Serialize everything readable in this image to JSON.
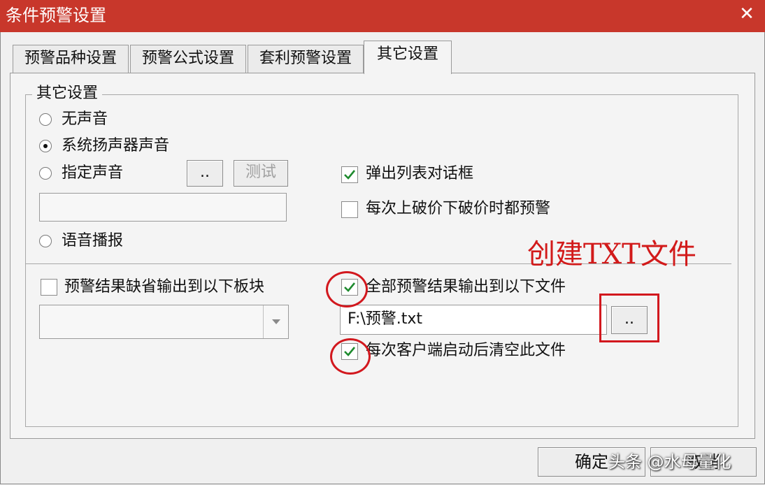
{
  "window": {
    "title": "条件预警设置",
    "close_glyph": "✕"
  },
  "tabs": [
    {
      "label": "预警品种设置",
      "active": false
    },
    {
      "label": "预警公式设置",
      "active": false
    },
    {
      "label": "套利预警设置",
      "active": false
    },
    {
      "label": "其它设置",
      "active": true
    }
  ],
  "group": {
    "title": "其它设置"
  },
  "sound": {
    "options": [
      {
        "label": "无声音",
        "selected": false
      },
      {
        "label": "系统扬声器声音",
        "selected": true
      },
      {
        "label": "指定声音",
        "selected": false
      },
      {
        "label": "语音播报",
        "selected": false
      }
    ],
    "browse_label": "..",
    "test_label": "测试",
    "path_value": ""
  },
  "options": {
    "popup_list": {
      "label": "弹出列表对话框",
      "checked": true
    },
    "every_breakout": {
      "label": "每次上破价下破价时都预警",
      "checked": false
    }
  },
  "output": {
    "to_block": {
      "label": "预警结果缺省输出到以下板块",
      "checked": false
    },
    "block_select_value": "",
    "to_file": {
      "label": "全部预警结果输出到以下文件",
      "checked": true
    },
    "file_path": "F:\\预警.txt",
    "file_browse_label": "..",
    "clear_on_start": {
      "label": "每次客户端启动后清空此文件",
      "checked": true
    }
  },
  "annotation": {
    "text": "创建TXT文件",
    "color": "#d21a1a"
  },
  "footer": {
    "ok_label": "确定",
    "cancel_label": "取消"
  },
  "watermark": "头条 @水母量化",
  "icons": {
    "check": "check-icon",
    "dropdown": "chevron-down-icon"
  }
}
